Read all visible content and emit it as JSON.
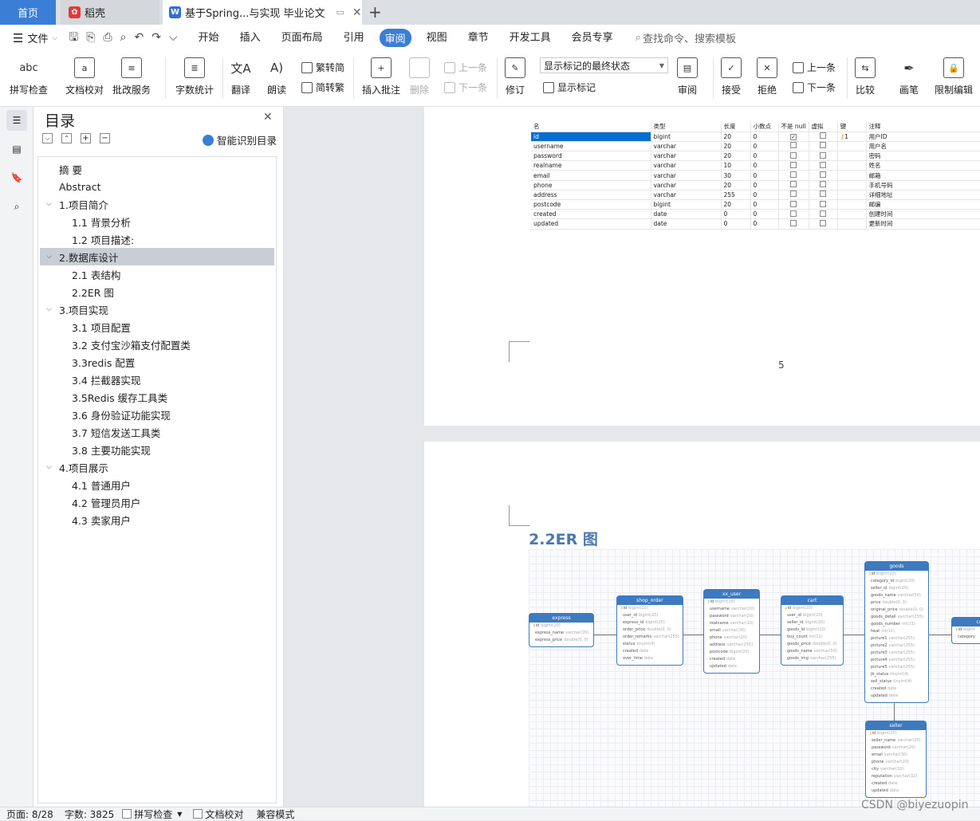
{
  "tabs": {
    "home": "首页",
    "daoke": "稻壳",
    "doc": "基于Spring...与实现 毕业论文",
    "new_tab": "+"
  },
  "menubar": {
    "file": "文件",
    "items": [
      "开始",
      "插入",
      "页面布局",
      "引用",
      "审阅",
      "视图",
      "章节",
      "开发工具",
      "会员专享"
    ],
    "active": "审阅",
    "search_placeholder": "查找命令、搜索模板"
  },
  "ribbon": {
    "spell": "拼写检查",
    "doccheck": "文档校对",
    "batch": "批改服务",
    "wordcount": "字数统计",
    "translate": "翻译",
    "read": "朗读",
    "trad": "繁转简",
    "simp": "简转繁",
    "insert_comment": "插入批注",
    "delete": "删除",
    "prev": "上一条",
    "next": "下一条",
    "revise": "修订",
    "markup_state": "显示标记的最终状态",
    "show_markup": "显示标记",
    "review": "审阅",
    "accept": "接受",
    "reject": "拒绝",
    "prev2": "上一条",
    "next2": "下一条",
    "compare": "比较",
    "pen": "画笔",
    "restrict": "限制编辑"
  },
  "toc": {
    "title": "目录",
    "smart": "智能识别目录",
    "items": [
      {
        "label": "摘  要",
        "level": 0
      },
      {
        "label": "Abstract",
        "level": 0
      },
      {
        "label": "1.项目简介",
        "level": 1
      },
      {
        "label": "1.1 背景分析",
        "level": 2
      },
      {
        "label": "1.2 项目描述:",
        "level": 2
      },
      {
        "label": "2.数据库设计",
        "level": 1
      },
      {
        "label": "2.1 表结构",
        "level": 2
      },
      {
        "label": "2.2ER 图",
        "level": 2
      },
      {
        "label": "3.项目实现",
        "level": 1
      },
      {
        "label": "3.1 项目配置",
        "level": 2
      },
      {
        "label": "3.2 支付宝沙箱支付配置类",
        "level": 2
      },
      {
        "label": "3.3redis 配置",
        "level": 2
      },
      {
        "label": "3.4 拦截器实现",
        "level": 2
      },
      {
        "label": "3.5Redis 缓存工具类",
        "level": 2
      },
      {
        "label": "3.6 身份验证功能实现",
        "level": 2
      },
      {
        "label": "3.7 短信发送工具类",
        "level": 2
      },
      {
        "label": "3.8 主要功能实现",
        "level": 2
      },
      {
        "label": "4.项目展示",
        "level": 1
      },
      {
        "label": "4.1 普通用户",
        "level": 2
      },
      {
        "label": "4.2 管理员用户",
        "level": 2
      },
      {
        "label": "4.3 卖家用户",
        "level": 2
      }
    ],
    "selected": "2.数据库设计"
  },
  "table": {
    "headers": [
      "名",
      "类型",
      "长度",
      "小数点",
      "不是 null",
      "虚拟",
      "键",
      "注释"
    ],
    "rows": [
      {
        "name": "id",
        "type": "bigint",
        "len": "20",
        "dec": "0",
        "notnull": true,
        "key": "1",
        "comment": "用户ID"
      },
      {
        "name": "username",
        "type": "varchar",
        "len": "20",
        "dec": "0",
        "notnull": false,
        "key": "",
        "comment": "用户名"
      },
      {
        "name": "password",
        "type": "varchar",
        "len": "20",
        "dec": "0",
        "notnull": false,
        "key": "",
        "comment": "密码"
      },
      {
        "name": "realname",
        "type": "varchar",
        "len": "10",
        "dec": "0",
        "notnull": false,
        "key": "",
        "comment": "姓名"
      },
      {
        "name": "email",
        "type": "varchar",
        "len": "30",
        "dec": "0",
        "notnull": false,
        "key": "",
        "comment": "邮箱"
      },
      {
        "name": "phone",
        "type": "varchar",
        "len": "20",
        "dec": "0",
        "notnull": false,
        "key": "",
        "comment": "手机号码"
      },
      {
        "name": "address",
        "type": "varchar",
        "len": "255",
        "dec": "0",
        "notnull": false,
        "key": "",
        "comment": "详细地址"
      },
      {
        "name": "postcode",
        "type": "bigint",
        "len": "20",
        "dec": "0",
        "notnull": false,
        "key": "",
        "comment": "邮编"
      },
      {
        "name": "created",
        "type": "date",
        "len": "0",
        "dec": "0",
        "notnull": false,
        "key": "",
        "comment": "创建时间"
      },
      {
        "name": "updated",
        "type": "date",
        "len": "0",
        "dec": "0",
        "notnull": false,
        "key": "",
        "comment": "更新时间"
      }
    ]
  },
  "page_number": "5",
  "er_heading": "2.2ER 图",
  "er": {
    "express": {
      "title": "express",
      "fields": [
        [
          "id",
          "bigint(20)"
        ],
        [
          "express_name",
          "varchar(20)"
        ],
        [
          "express_price",
          "double(0, 0)"
        ]
      ]
    },
    "shop_order": {
      "title": "shop_order",
      "fields": [
        [
          "id",
          "bigint(20)"
        ],
        [
          "user_id",
          "bigint(20)"
        ],
        [
          "express_id",
          "bigint(20)"
        ],
        [
          "order_price",
          "double(0, 0)"
        ],
        [
          "order_remarks",
          "varchar(255)"
        ],
        [
          "status",
          "tinyint(4)"
        ],
        [
          "created",
          "date"
        ],
        [
          "over_time",
          "date"
        ]
      ]
    },
    "xx_user": {
      "title": "xx_user",
      "fields": [
        [
          "id",
          "bigint(20)"
        ],
        [
          "username",
          "varchar(20)"
        ],
        [
          "password",
          "varchar(20)"
        ],
        [
          "realname",
          "varchar(10)"
        ],
        [
          "email",
          "varchar(30)"
        ],
        [
          "phone",
          "varchar(20)"
        ],
        [
          "address",
          "varchar(255)"
        ],
        [
          "postcode",
          "bigint(20)"
        ],
        [
          "created",
          "date"
        ],
        [
          "updated",
          "date"
        ]
      ]
    },
    "cart": {
      "title": "cart",
      "fields": [
        [
          "id",
          "bigint(20)"
        ],
        [
          "user_id",
          "bigint(20)"
        ],
        [
          "seller_id",
          "bigint(20)"
        ],
        [
          "goods_id",
          "bigint(20)"
        ],
        [
          "buy_count",
          "int(11)"
        ],
        [
          "goods_price",
          "double(0, 0)"
        ],
        [
          "goods_name",
          "varchar(50)"
        ],
        [
          "goods_img",
          "varchar(255)"
        ]
      ]
    },
    "goods": {
      "title": "goods",
      "fields": [
        [
          "id",
          "bigint(20)"
        ],
        [
          "category_id",
          "bigint(20)"
        ],
        [
          "seller_id",
          "bigint(20)"
        ],
        [
          "goods_name",
          "varchar(50)"
        ],
        [
          "price",
          "double(0, 0)"
        ],
        [
          "original_price",
          "double(0, 0)"
        ],
        [
          "goods_detail",
          "varchar(255)"
        ],
        [
          "goods_number",
          "int(11)"
        ],
        [
          "heat",
          "int(11)"
        ],
        [
          "picture1",
          "varchar(255)"
        ],
        [
          "picture2",
          "varchar(255)"
        ],
        [
          "picture3",
          "varchar(255)"
        ],
        [
          "picture4",
          "varchar(255)"
        ],
        [
          "picture5",
          "varchar(255)"
        ],
        [
          "jb_status",
          "tinyint(4)"
        ],
        [
          "sell_status",
          "tinyint(4)"
        ],
        [
          "created",
          "date"
        ],
        [
          "updated",
          "date"
        ]
      ]
    },
    "seller": {
      "title": "seller",
      "fields": [
        [
          "id",
          "bigint(20)"
        ],
        [
          "seller_name",
          "varchar(20)"
        ],
        [
          "password",
          "varchar(20)"
        ],
        [
          "email",
          "varchar(30)"
        ],
        [
          "phone",
          "varchar(20)"
        ],
        [
          "city",
          "varchar(10)"
        ],
        [
          "reputation",
          "varchar(32)"
        ],
        [
          "created",
          "date"
        ],
        [
          "updated",
          "date"
        ]
      ]
    },
    "partial": {
      "title": "ca",
      "fields": [
        [
          "id",
          "bigint"
        ],
        [
          "category",
          ""
        ]
      ]
    }
  },
  "status": {
    "page": "页面: 8/28",
    "words": "字数: 3825",
    "spell": "拼写检查",
    "doccheck": "文档校对",
    "compat": "兼容模式"
  },
  "watermark": "CSDN @biyezuopin"
}
